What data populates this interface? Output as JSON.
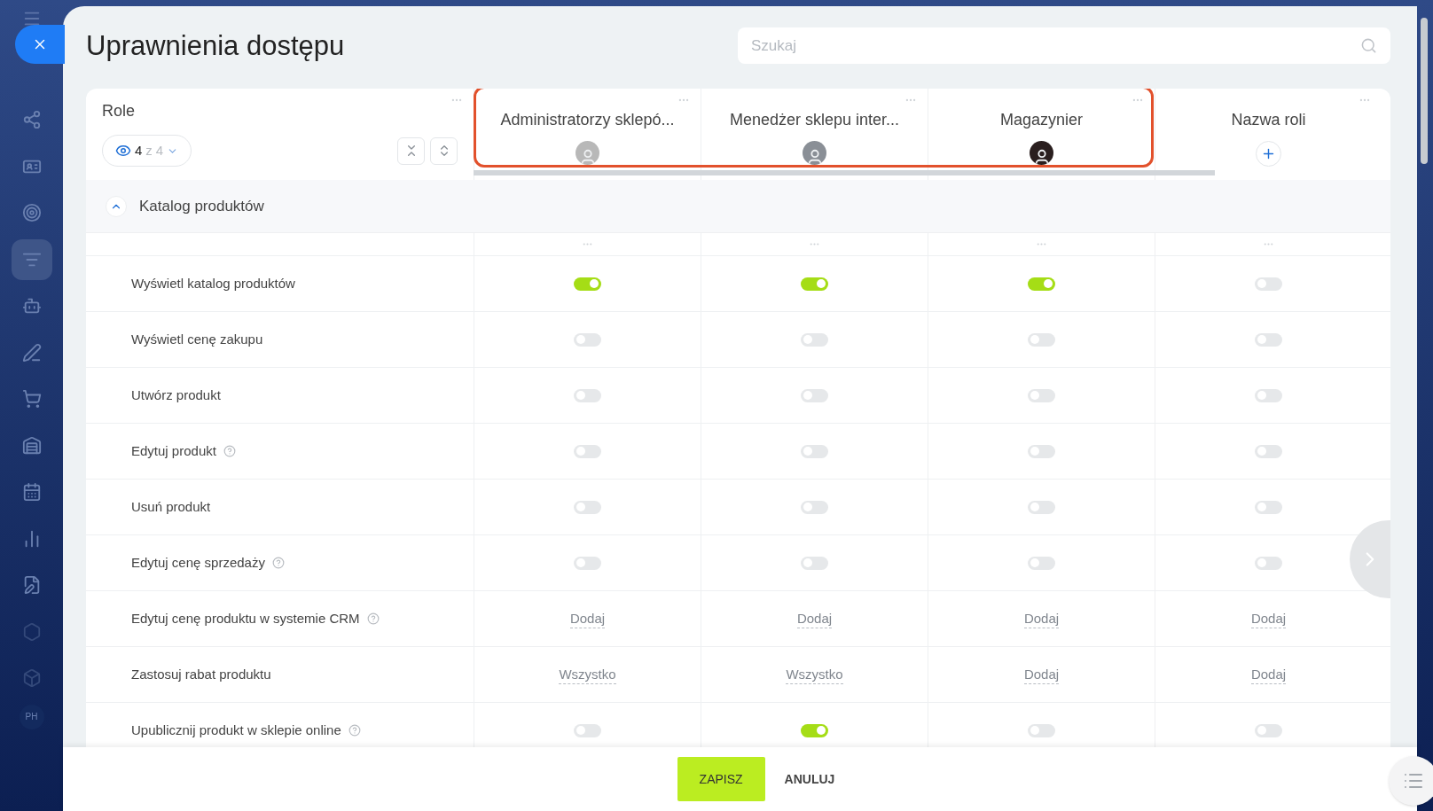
{
  "sidebar": {
    "items": [
      {
        "selected": false
      },
      {
        "selected": false
      },
      {
        "selected": false
      },
      {
        "selected": true
      },
      {
        "selected": false
      },
      {
        "selected": false
      },
      {
        "selected": false
      },
      {
        "selected": false
      },
      {
        "selected": false
      },
      {
        "selected": false
      },
      {
        "selected": false
      },
      {
        "selected": false
      },
      {
        "selected": false
      }
    ],
    "badge": "PH"
  },
  "title": "Uprawnienia dostępu",
  "search": {
    "placeholder": "Szukaj"
  },
  "roles_header": {
    "label": "Role",
    "filter": {
      "shown": "4",
      "separator": "z",
      "total": "4"
    }
  },
  "roles": [
    {
      "name": "Administratorzy sklepó...",
      "color": "#b8b8b8"
    },
    {
      "name": "Menedżer sklepu inter...",
      "color": "#8a8f96"
    },
    {
      "name": "Magazynier",
      "color": "#2a1f1f"
    }
  ],
  "new_role": {
    "name": "Nazwa roli"
  },
  "section": {
    "title": "Katalog produktów",
    "expanded": true
  },
  "rows": [
    {
      "label": "Wyświetl katalog produktów",
      "help": false,
      "kind": "toggle",
      "cells": [
        {
          "on": true
        },
        {
          "on": true
        },
        {
          "on": true
        },
        {
          "on": false
        }
      ]
    },
    {
      "label": "Wyświetl cenę zakupu",
      "help": false,
      "kind": "toggle",
      "cells": [
        {
          "on": false
        },
        {
          "on": false
        },
        {
          "on": false
        },
        {
          "on": false
        }
      ]
    },
    {
      "label": "Utwórz produkt",
      "help": false,
      "kind": "toggle",
      "cells": [
        {
          "on": false
        },
        {
          "on": false
        },
        {
          "on": false
        },
        {
          "on": false
        }
      ]
    },
    {
      "label": "Edytuj produkt",
      "help": true,
      "kind": "toggle",
      "cells": [
        {
          "on": false
        },
        {
          "on": false
        },
        {
          "on": false
        },
        {
          "on": false
        }
      ]
    },
    {
      "label": "Usuń produkt",
      "help": false,
      "kind": "toggle",
      "cells": [
        {
          "on": false
        },
        {
          "on": false
        },
        {
          "on": false
        },
        {
          "on": false
        }
      ]
    },
    {
      "label": "Edytuj cenę sprzedaży",
      "help": true,
      "kind": "toggle",
      "cells": [
        {
          "on": false
        },
        {
          "on": false
        },
        {
          "on": false
        },
        {
          "on": false
        }
      ]
    },
    {
      "label": "Edytuj cenę produktu w systemie CRM",
      "help": true,
      "kind": "link",
      "cells": [
        {
          "text": "Dodaj"
        },
        {
          "text": "Dodaj"
        },
        {
          "text": "Dodaj"
        },
        {
          "text": "Dodaj"
        }
      ]
    },
    {
      "label": "Zastosuj rabat produktu",
      "help": false,
      "kind": "link",
      "cells": [
        {
          "text": "Wszystko"
        },
        {
          "text": "Wszystko"
        },
        {
          "text": "Dodaj"
        },
        {
          "text": "Dodaj"
        }
      ]
    },
    {
      "label": "Upublicznij produkt w sklepie online",
      "help": true,
      "kind": "toggle",
      "cells": [
        {
          "on": false
        },
        {
          "on": true
        },
        {
          "on": false
        },
        {
          "on": false
        }
      ]
    }
  ],
  "footer": {
    "save": "ZAPISZ",
    "cancel": "ANULUJ"
  }
}
